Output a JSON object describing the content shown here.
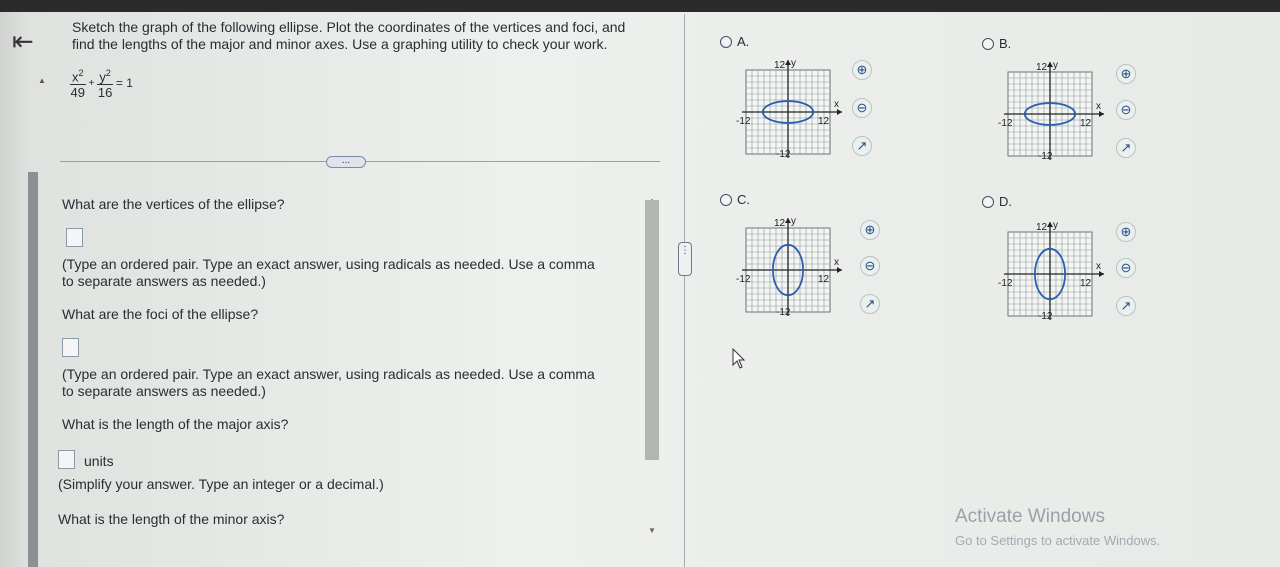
{
  "problem": {
    "back_icon": "back-arrow-icon",
    "prompt_line1": "Sketch the graph of the following ellipse. Plot the coordinates of the vertices and foci, and",
    "prompt_line2": "find the lengths of the major and minor axes. Use a graphing utility to check your work.",
    "equation": {
      "x_num": "x",
      "x_exp": "2",
      "x_den": "49",
      "plus": "+",
      "y_num": "y",
      "y_exp": "2",
      "y_den": "16",
      "rhs": "= 1"
    },
    "more_label": "..."
  },
  "questions": {
    "vertices": "What are the vertices of the ellipse?",
    "vertices_hint1": "(Type an ordered pair. Type an exact answer, using radicals as needed. Use a comma",
    "vertices_hint2": "to separate answers as needed.)",
    "foci": "What are the foci of the ellipse?",
    "foci_hint1": "(Type an ordered pair. Type an exact answer, using radicals as needed. Use a comma",
    "foci_hint2": "to separate answers as needed.)",
    "major": "What is the length of the major axis?",
    "major_units": "units",
    "major_hint": "(Simplify your answer. Type an integer or a decimal.)",
    "minor": "What is the length of the minor axis?"
  },
  "options": [
    {
      "label": "A.",
      "orientation": "horizontal",
      "top_tick": "12",
      "left_tick": "-12",
      "right_tick": "12",
      "bottom_tick": "-12",
      "x_axis": "x",
      "y_axis": "y"
    },
    {
      "label": "B.",
      "orientation": "horizontal",
      "top_tick": "12",
      "left_tick": "-12",
      "right_tick": "12",
      "bottom_tick": "-12",
      "x_axis": "x",
      "y_axis": "y"
    },
    {
      "label": "C.",
      "orientation": "vertical",
      "top_tick": "12",
      "left_tick": "-12",
      "right_tick": "12",
      "bottom_tick": "-12",
      "x_axis": "x",
      "y_axis": "y"
    },
    {
      "label": "D.",
      "orientation": "vertical",
      "top_tick": "12",
      "left_tick": "-12",
      "right_tick": "12",
      "bottom_tick": "-12",
      "x_axis": "x",
      "y_axis": "y"
    }
  ],
  "tools": {
    "zoom_in_icon": "zoom-in-icon",
    "zoom_out_icon": "zoom-out-icon",
    "popout_icon": "popout-icon"
  },
  "watermark": {
    "title": "Activate Windows",
    "subtitle": "Go to Settings to activate Windows."
  }
}
